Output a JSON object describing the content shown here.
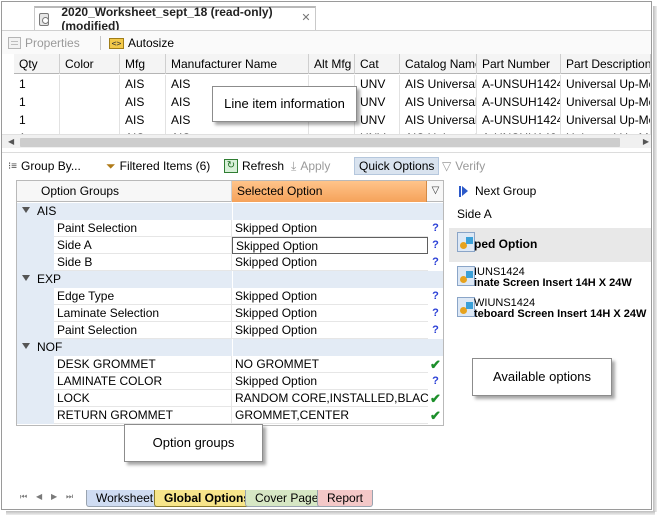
{
  "window": {
    "title": "2020_Worksheet_sept_18 (read-only) (modified)",
    "close_glyph": "✕"
  },
  "property_toolbar": {
    "properties_label": "Properties",
    "autosize_label": "Autosize",
    "autosize_icon_text": "<>"
  },
  "line_items": {
    "columns": [
      "Qty",
      "Color",
      "Mfg",
      "Manufacturer Name",
      "Alt Mfg",
      "Cat",
      "Catalog Name",
      "Part Number",
      "Part Description"
    ],
    "rows": [
      [
        "1",
        "",
        "AIS",
        "AIS",
        "",
        "UNV",
        "AIS Universal",
        "A-UNSUH1424",
        "Universal Up-Mount"
      ],
      [
        "1",
        "",
        "AIS",
        "AIS",
        "",
        "UNV",
        "AIS Universal",
        "A-UNSUH1424",
        "Universal Up-Mount"
      ],
      [
        "1",
        "",
        "AIS",
        "AIS",
        "",
        "UNV",
        "AIS Universal",
        "A-UNSUH1424",
        "Universal Up-Mount"
      ],
      [
        "1",
        "",
        "AIS",
        "AIS",
        "",
        "UNV",
        "AIS Universal",
        "A-UNSUH1424",
        "Universal Up-Mount"
      ]
    ]
  },
  "options_toolbar": {
    "group_by": "Group By...",
    "filtered_items": "Filtered Items (6)",
    "refresh": "Refresh",
    "apply": "Apply",
    "quick_options": "Quick Options",
    "verify": "Verify"
  },
  "option_grid": {
    "header_groups": "Option Groups",
    "header_selected": "Selected Option",
    "groups": [
      {
        "name": "AIS",
        "options": [
          {
            "name": "Paint Selection",
            "value": "Skipped Option",
            "status": "?"
          },
          {
            "name": "Side A",
            "value": "Skipped Option",
            "status": "?"
          },
          {
            "name": "Side B",
            "value": "Skipped Option",
            "status": "?"
          }
        ]
      },
      {
        "name": "EXP",
        "options": [
          {
            "name": "Edge Type",
            "value": "Skipped Option",
            "status": "?"
          },
          {
            "name": "Laminate Selection",
            "value": "Skipped Option",
            "status": "?"
          },
          {
            "name": "Paint Selection",
            "value": "Skipped Option",
            "status": "?"
          }
        ]
      },
      {
        "name": "NOF",
        "options": [
          {
            "name": "DESK GROMMET",
            "value": "NO GROMMET",
            "status": "✔"
          },
          {
            "name": "LAMINATE COLOR",
            "value": "Skipped Option",
            "status": "?"
          },
          {
            "name": "LOCK",
            "value": "RANDOM CORE,INSTALLED,BLACK",
            "status": "✔"
          },
          {
            "name": "RETURN GROMMET",
            "value": "GROMMET,CENTER",
            "status": "✔"
          }
        ]
      }
    ]
  },
  "right_panel": {
    "next_group": "Next Group",
    "side_title": "Side A",
    "options": [
      {
        "line1": "ped Option",
        "line2": ""
      },
      {
        "line1": "IUNS1424",
        "line2": "inate Screen Insert 14H X 24W"
      },
      {
        "line1": "WIUNS1424",
        "line2": "teboard Screen Insert 14H X 24W"
      }
    ]
  },
  "sheet_tabs": [
    "Worksheet",
    "Global Options",
    "Cover Page",
    "Report"
  ],
  "sheet_nav": [
    "⏮",
    "◀",
    "▶",
    "⏭"
  ],
  "callouts": {
    "line_items": "Line item information",
    "option_groups": "Option groups",
    "available_options": "Available options"
  },
  "colors": {
    "selected_header": "#f5a25a",
    "group_row": "#e3ebf5",
    "tab_worksheet": "#cfdcf2",
    "tab_global_options": "#f7e58a",
    "tab_cover_page": "#d6e7c4",
    "tab_report": "#f4c8c8"
  }
}
